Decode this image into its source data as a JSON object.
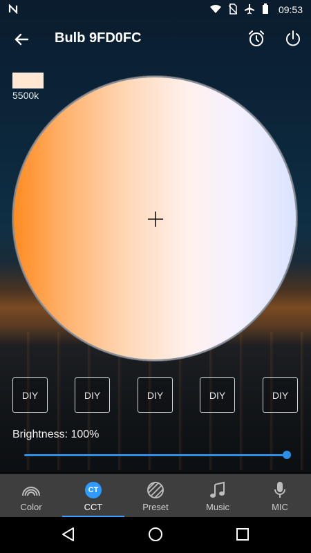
{
  "status_bar": {
    "time": "09:53",
    "icons": [
      "notification-n-icon",
      "wifi-icon",
      "no-sim-icon",
      "airplane-icon",
      "battery-icon"
    ]
  },
  "app_bar": {
    "title": "Bulb 9FD0FC",
    "icons": [
      "back-arrow-icon",
      "alarm-clock-icon",
      "power-icon"
    ]
  },
  "cct": {
    "value_label": "5500k",
    "swatch_color": "#ffe7d2",
    "wheel_colors": [
      "#ff8a1e",
      "#ffd7b6",
      "#fff1ee",
      "#d9e3ff"
    ]
  },
  "diy_buttons": [
    "DIY",
    "DIY",
    "DIY",
    "DIY",
    "DIY"
  ],
  "brightness": {
    "label": "Brightness: 100%",
    "value_percent": 100,
    "accent_color": "#2a8fe6"
  },
  "tabs": [
    {
      "label": "Color",
      "icon": "rainbow-icon",
      "active": false
    },
    {
      "label": "CCT",
      "icon": "ct-badge-icon",
      "badge_text": "CT",
      "active": true
    },
    {
      "label": "Preset",
      "icon": "striped-circle-icon",
      "active": false
    },
    {
      "label": "Music",
      "icon": "music-note-icon",
      "active": false
    },
    {
      "label": "MIC",
      "icon": "microphone-icon",
      "active": false
    }
  ],
  "nav_bar": {
    "icons": [
      "nav-back-icon",
      "nav-home-icon",
      "nav-recent-icon"
    ]
  }
}
